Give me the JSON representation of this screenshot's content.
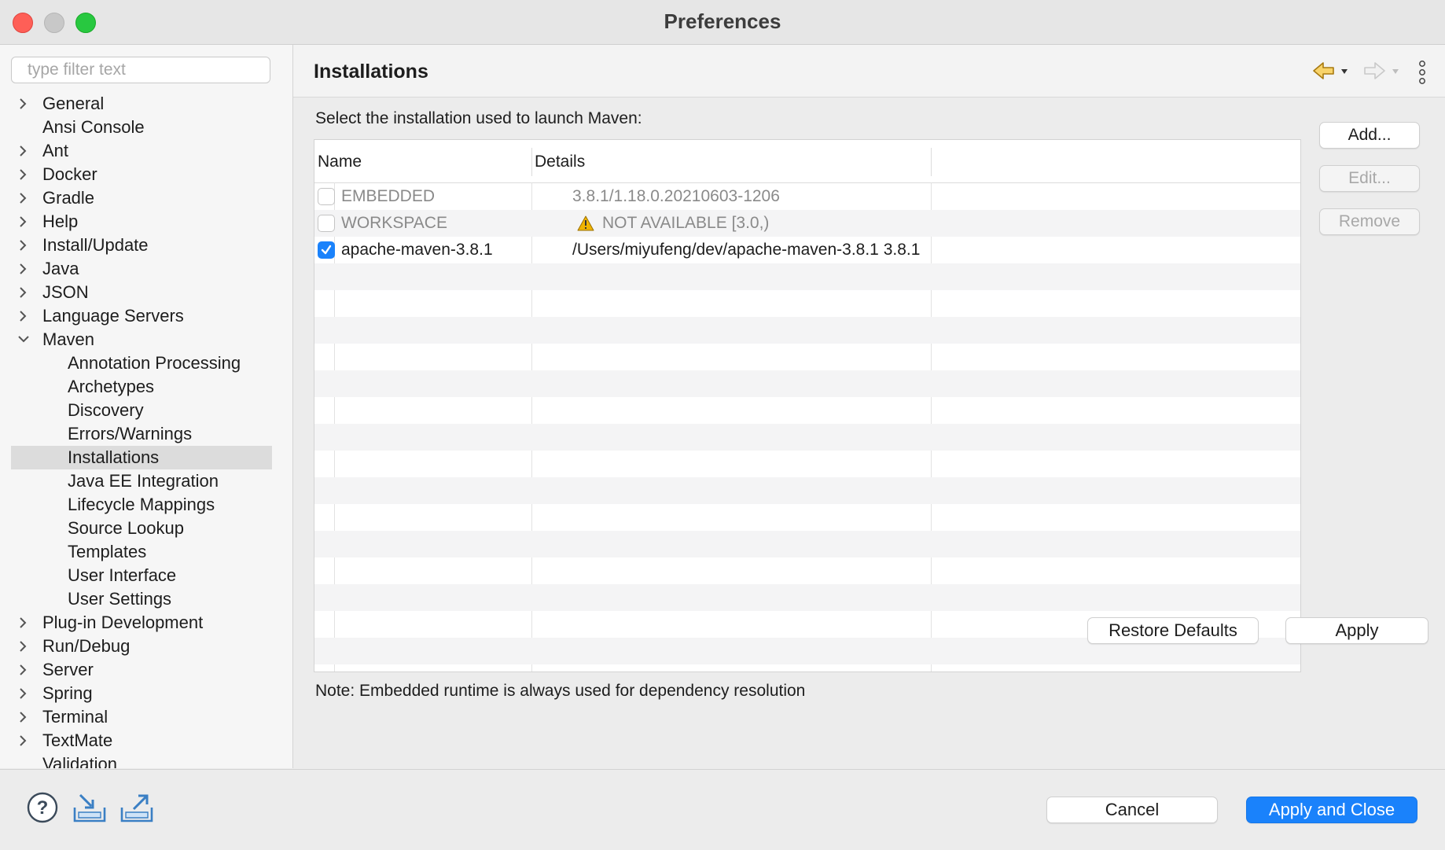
{
  "window": {
    "title": "Preferences"
  },
  "sidebar": {
    "filter_placeholder": "type filter text",
    "items": [
      {
        "label": "General",
        "expandable": true
      },
      {
        "label": "Ansi Console",
        "expandable": false
      },
      {
        "label": "Ant",
        "expandable": true
      },
      {
        "label": "Docker",
        "expandable": true
      },
      {
        "label": "Gradle",
        "expandable": true
      },
      {
        "label": "Help",
        "expandable": true
      },
      {
        "label": "Install/Update",
        "expandable": true
      },
      {
        "label": "Java",
        "expandable": true
      },
      {
        "label": "JSON",
        "expandable": true
      },
      {
        "label": "Language Servers",
        "expandable": true
      },
      {
        "label": "Maven",
        "expandable": true,
        "expanded": true
      },
      {
        "label": "Annotation Processing",
        "child": true
      },
      {
        "label": "Archetypes",
        "child": true
      },
      {
        "label": "Discovery",
        "child": true
      },
      {
        "label": "Errors/Warnings",
        "child": true
      },
      {
        "label": "Installations",
        "child": true,
        "selected": true
      },
      {
        "label": "Java EE Integration",
        "child": true
      },
      {
        "label": "Lifecycle Mappings",
        "child": true
      },
      {
        "label": "Source Lookup",
        "child": true
      },
      {
        "label": "Templates",
        "child": true
      },
      {
        "label": "User Interface",
        "child": true
      },
      {
        "label": "User Settings",
        "child": true
      },
      {
        "label": "Plug-in Development",
        "expandable": true
      },
      {
        "label": "Run/Debug",
        "expandable": true
      },
      {
        "label": "Server",
        "expandable": true
      },
      {
        "label": "Spring",
        "expandable": true
      },
      {
        "label": "Terminal",
        "expandable": true
      },
      {
        "label": "TextMate",
        "expandable": true
      },
      {
        "label": "Validation",
        "expandable": false
      }
    ]
  },
  "main": {
    "title": "Installations",
    "nav_icons": [
      "back-arrow-icon",
      "forward-arrow-icon",
      "more-vertical-icon"
    ],
    "instructions": "Select the installation used to launch Maven:",
    "table": {
      "columns": [
        "Name",
        "Details"
      ],
      "rows": [
        {
          "name": "EMBEDDED",
          "details": "3.8.1/1.18.0.20210603-1206",
          "checked": false,
          "disabled": true,
          "warning": false
        },
        {
          "name": "WORKSPACE",
          "details": "NOT AVAILABLE [3.0,)",
          "checked": false,
          "disabled": true,
          "warning": true
        },
        {
          "name": "apache-maven-3.8.1",
          "details": "/Users/miyufeng/dev/apache-maven-3.8.1 3.8.1",
          "checked": true,
          "disabled": false,
          "warning": false
        }
      ]
    },
    "side_buttons": {
      "add": "Add...",
      "edit": "Edit...",
      "remove": "Remove"
    },
    "note": "Note: Embedded runtime is always used for dependency resolution",
    "restore_defaults": "Restore Defaults",
    "apply": "Apply"
  },
  "footer": {
    "icons": [
      "help-icon",
      "import-icon",
      "export-icon"
    ],
    "cancel": "Cancel",
    "apply_and_close": "Apply and Close"
  },
  "colors": {
    "accent": "#1a82fb",
    "selection": "#dcdcdc",
    "warning": "#f0b400"
  }
}
